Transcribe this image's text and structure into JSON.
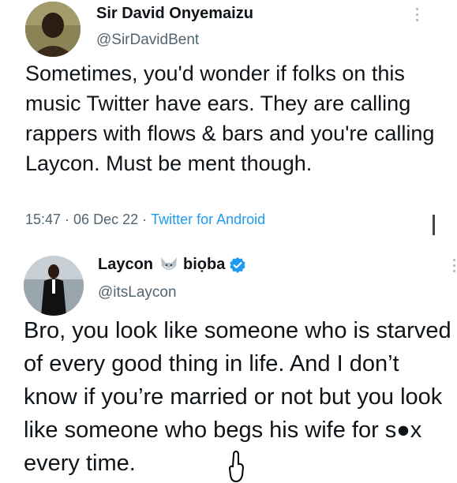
{
  "tweets": [
    {
      "author": {
        "name": "Sir David Onyemaizu",
        "handle": "@SirDavidBent"
      },
      "body": "Sometimes, you'd wonder if folks on this music Twitter have ears. They are calling rappers with flows & bars and you're calling Laycon. Must be ment though.",
      "meta": {
        "time": "15:47",
        "separator": "·",
        "date": "06 Dec 22",
        "source": "Twitter for Android"
      },
      "icons": {
        "avatar": "avatar",
        "more": "more-options-icon"
      }
    },
    {
      "author": {
        "name": "Laycon",
        "name_suffix": "biọba",
        "handle": "@itsLaycon",
        "verified": true
      },
      "body": "Bro, you look like someone who is starved of every good thing in life. And I don’t know if you’re married or not but you look like someone who begs his wife for s●x every time.",
      "icons": {
        "avatar": "avatar",
        "name_emoji": "fox-icon",
        "verified": "verified-badge-icon",
        "more": "more-options-icon",
        "overlay": "hand-cursor-icon"
      }
    }
  ],
  "colors": {
    "text": "#0f1419",
    "secondary": "#536471",
    "link": "#1d9bf0",
    "verified": "#1d9bf0"
  }
}
